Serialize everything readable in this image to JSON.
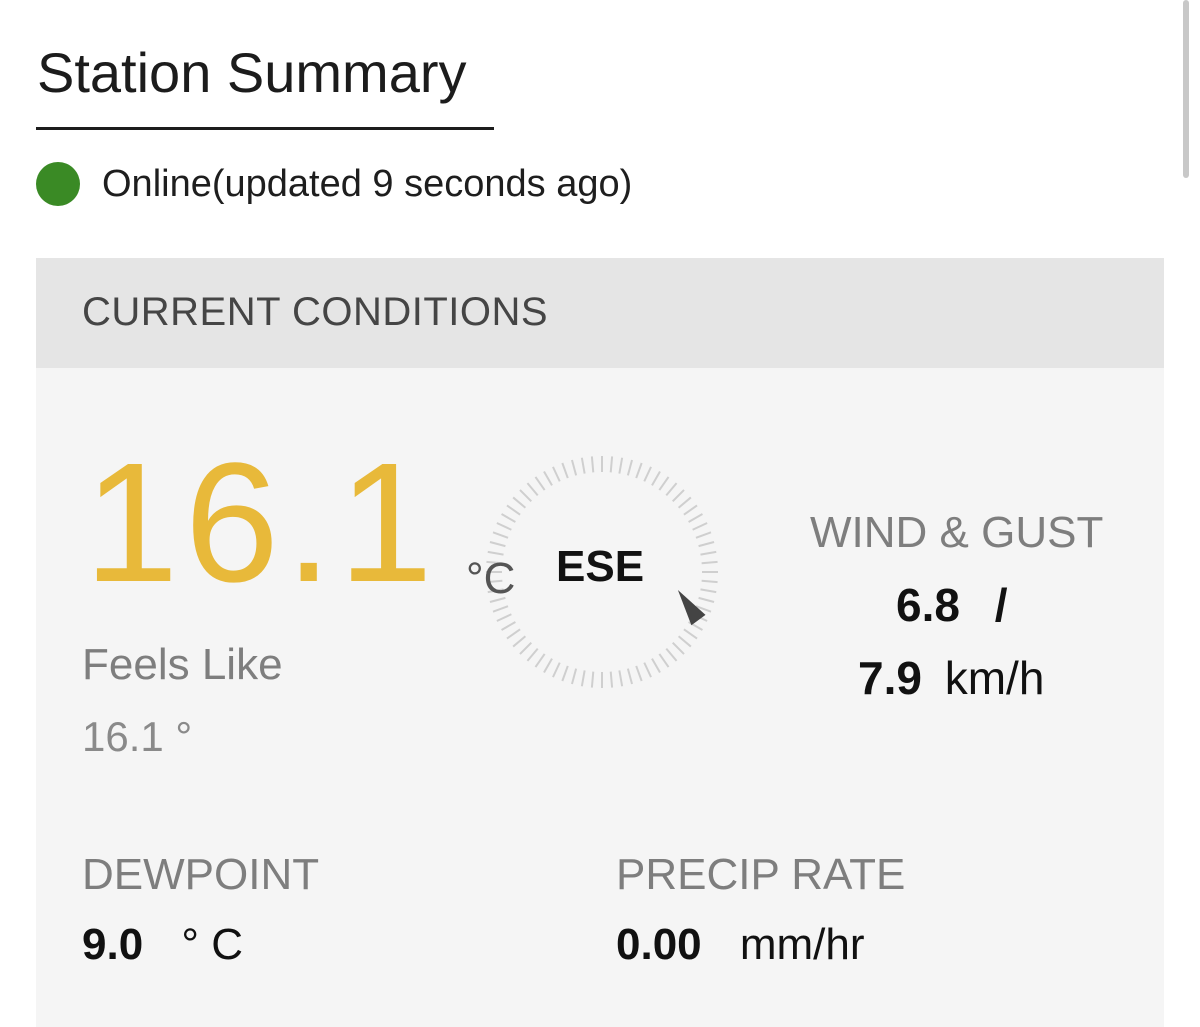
{
  "header": {
    "title": "Station Summary"
  },
  "status": {
    "text": "Online(updated 9 seconds ago)",
    "color": "#3a8a25"
  },
  "current_conditions": {
    "heading": "CURRENT CONDITIONS",
    "temperature": {
      "value": "16.1",
      "unit": "°C",
      "color": "#e8b93a"
    },
    "feels_like": {
      "label": "Feels Like",
      "value": "16.1 °"
    },
    "wind": {
      "direction": "ESE",
      "direction_degrees": 112.5,
      "label": "WIND & GUST",
      "speed": "6.8",
      "separator": "/",
      "gust": "7.9",
      "unit": "km/h"
    },
    "dewpoint": {
      "label": "DEWPOINT",
      "value": "9.0",
      "unit": "° C"
    },
    "precip_rate": {
      "label": "PRECIP RATE",
      "value": "0.00",
      "unit": "mm/hr"
    }
  }
}
